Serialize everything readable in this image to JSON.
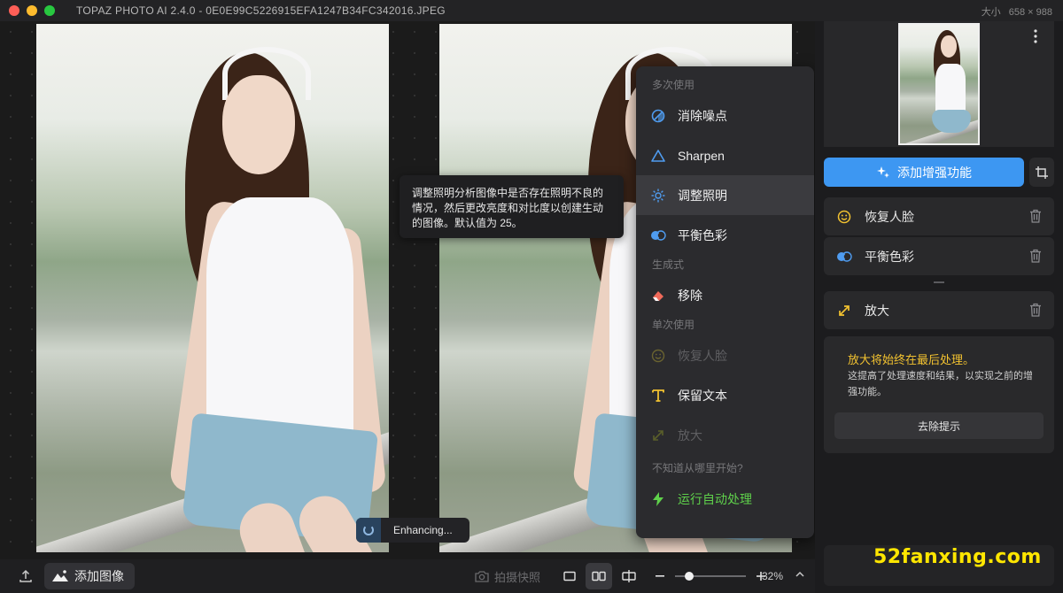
{
  "window": {
    "title": "TOPAZ PHOTO AI 2.4.0 - 0E0E99C5226915EFA1247B34FC342016.JPEG",
    "size_label": "大小",
    "size_value": "658 × 988"
  },
  "tooltip": {
    "text": "调整照明分析图像中是否存在照明不良的情况，然后更改亮度和对比度以创建生动的图像。默认值为 25。"
  },
  "menu": {
    "section_frequent": "多次使用",
    "items_frequent": [
      {
        "label": "消除噪点",
        "icon": "denoise-icon"
      },
      {
        "label": "Sharpen",
        "icon": "sharpen-triangle-icon"
      },
      {
        "label": "调整照明",
        "icon": "sun-icon"
      },
      {
        "label": "平衡色彩",
        "icon": "color-balance-icon"
      }
    ],
    "section_generative": "生成式",
    "items_generative": [
      {
        "label": "移除",
        "icon": "eraser-icon"
      }
    ],
    "section_single": "单次使用",
    "items_single": [
      {
        "label": "恢复人脸",
        "icon": "face-icon"
      },
      {
        "label": "保留文本",
        "icon": "text-icon"
      },
      {
        "label": "放大",
        "icon": "upscale-icon"
      }
    ],
    "section_start": "不知道从哪里开始?",
    "auto_label": "运行自动处理"
  },
  "status": {
    "enhancing": "Enhancing..."
  },
  "bottombar": {
    "add_image": "添加图像",
    "snapshot": "拍摄快照",
    "zoom_value": "32%",
    "zoom_fraction": 0.2
  },
  "panel": {
    "add_enhancement": "添加增强功能",
    "features": [
      {
        "label": "恢复人脸",
        "icon": "face-icon"
      },
      {
        "label": "平衡色彩",
        "icon": "color-balance-icon"
      },
      {
        "label": "放大",
        "icon": "upscale-icon"
      }
    ],
    "hint_title": "放大将始终在最后处理。",
    "hint_body": "这提高了处理速度和结果，以实现之前的增强功能。",
    "dismiss": "去除提示"
  },
  "watermark": "52fanxing.com",
  "colors": {
    "accent": "#3d97f2",
    "auto_green": "#5fd14b",
    "hint_yellow": "#f2c230",
    "watermark": "#ffe600"
  }
}
